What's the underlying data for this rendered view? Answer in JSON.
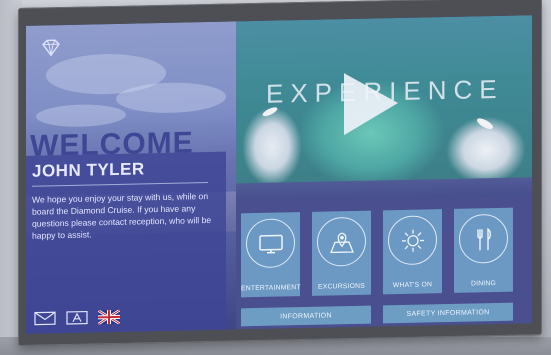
{
  "welcome": {
    "title": "WELCOME",
    "guest_name": "JOHN TYLER",
    "message": "We hope you enjoy your stay with us, while on board the Diamond Cruise. If you have any questions please contact reception, who will be happy to assist."
  },
  "video": {
    "title": "EXPERIENCE",
    "icon": "play-icon"
  },
  "tiles": [
    {
      "label": "ENTERTAINMENT",
      "icon": "tv-icon"
    },
    {
      "label": "EXCURSIONS",
      "icon": "map-pin-icon"
    },
    {
      "label": "WHAT'S ON",
      "icon": "sun-icon"
    },
    {
      "label": "DINING",
      "icon": "cutlery-icon"
    }
  ],
  "bars": {
    "information": "INFORMATION",
    "safety": "SAFETY INFORMATION"
  },
  "bottom_icons": [
    "mail-icon",
    "font-size-icon",
    "uk-flag-icon"
  ],
  "colors": {
    "brand_blue": "#3d4793",
    "tile_blue": "#74aace",
    "bezel": "#4d4f55"
  }
}
